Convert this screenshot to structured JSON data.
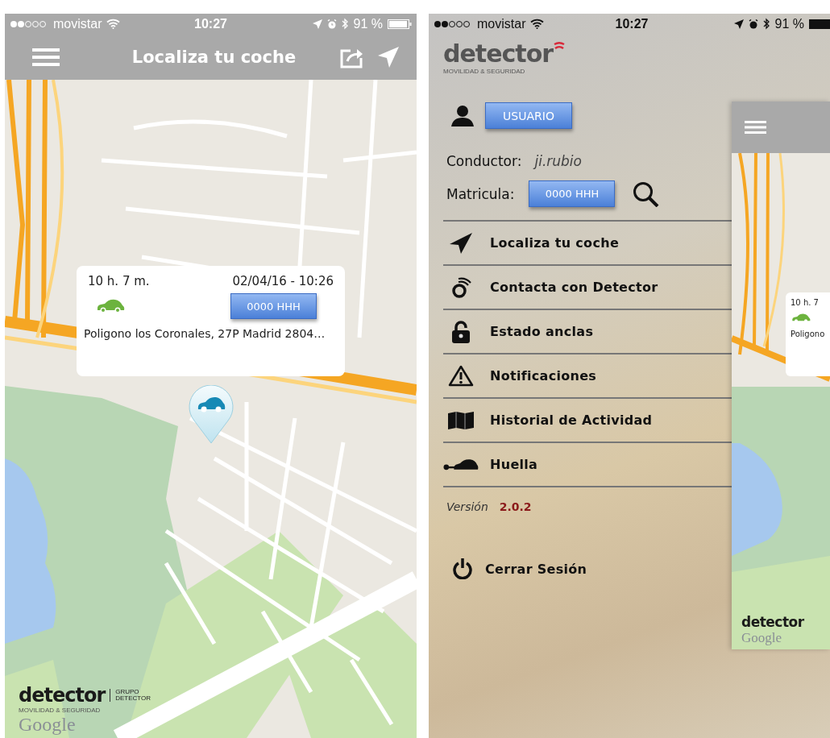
{
  "left_screen": {
    "status_bar": {
      "carrier": "movistar",
      "time": "10:27",
      "battery": "91 %"
    },
    "header": {
      "title": "Localiza tu coche"
    },
    "callout": {
      "duration": "10 h. 7 m.",
      "datetime": "02/04/16 - 10:26",
      "plate": "0000 HHH",
      "address": "Poligono los Coronales, 27P Madrid 2804…"
    },
    "logo": {
      "word": "detector",
      "tagline": "MOVILIDAD & SEGURIDAD",
      "group_lines": [
        "GRUPO",
        "DETECTOR"
      ]
    },
    "map_credit": "Google"
  },
  "right_screen": {
    "status_bar": {
      "carrier": "movistar",
      "time": "10:27",
      "battery": "91 %"
    },
    "logo": {
      "word": "detector",
      "tagline": "MOVILIDAD & SEGURIDAD"
    },
    "user_button": "USUARIO",
    "driver": {
      "label": "Conductor:",
      "value": "ji.rubio"
    },
    "plate": {
      "label": "Matricula:",
      "value": "0000 HHH"
    },
    "menu": [
      {
        "label": "Localiza tu coche"
      },
      {
        "label": "Contacta con Detector"
      },
      {
        "label": "Estado anclas"
      },
      {
        "label": "Notificaciones"
      },
      {
        "label": "Historial de Actividad"
      },
      {
        "label": "Huella"
      }
    ],
    "version": {
      "label": "Versión",
      "value": "2.0.2"
    },
    "logout": "Cerrar Sesión",
    "preview": {
      "duration": "10 h. 7",
      "address": "Poligono",
      "logo_word": "detector",
      "map_credit": "Google"
    }
  }
}
